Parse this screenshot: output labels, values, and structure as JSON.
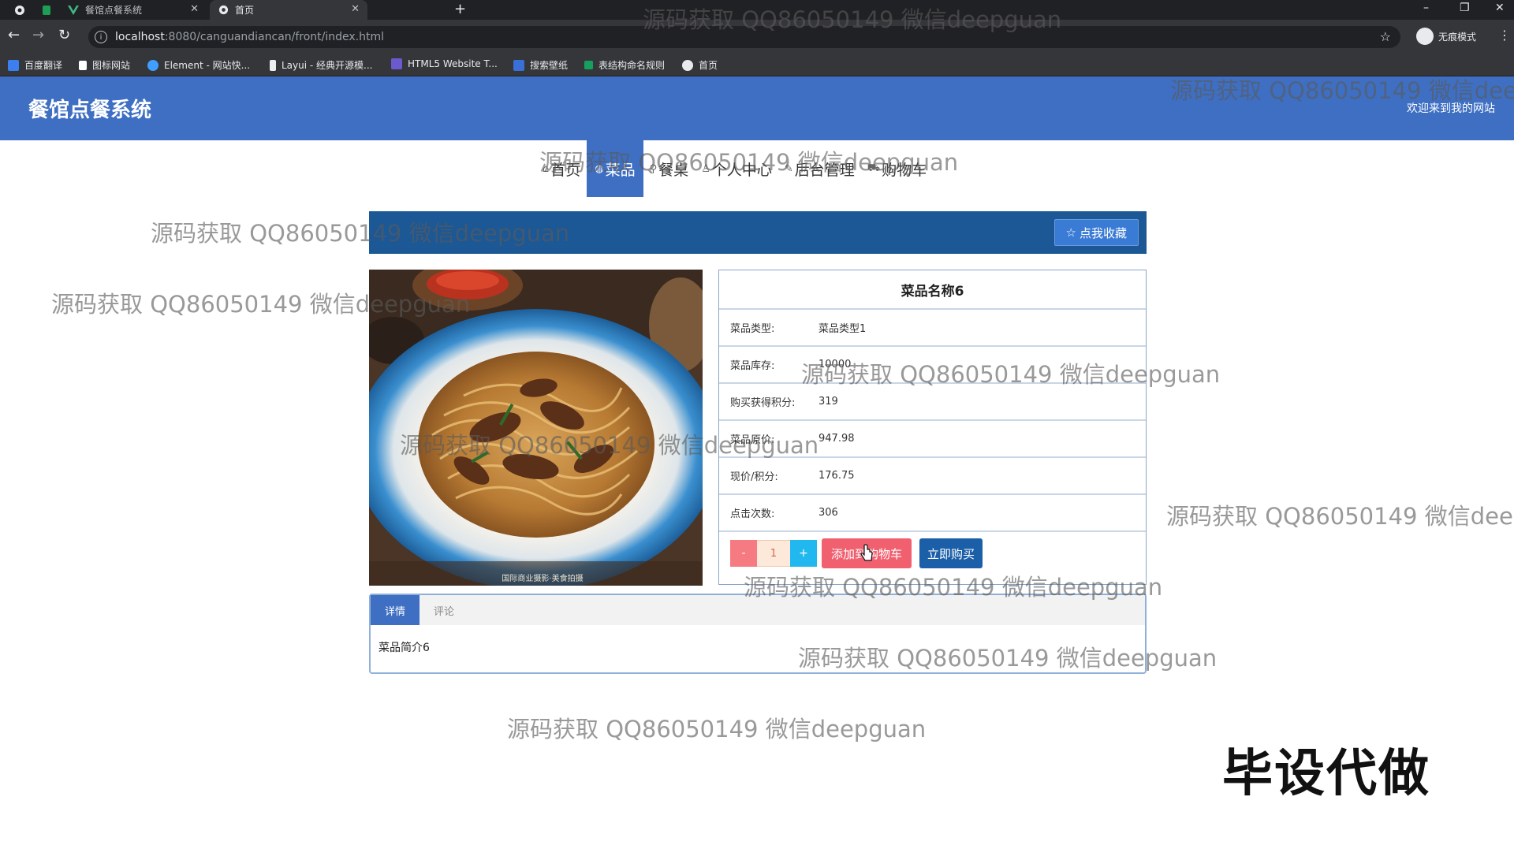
{
  "browser": {
    "tabs": [
      {
        "title": "餐馆点餐系统"
      },
      {
        "title": "首页"
      }
    ],
    "url_host": "localhost",
    "url_rest": ":8080/canguandiancan/front/index.html",
    "incognito_label": "无痕模式",
    "bookmarks": [
      {
        "label": "百度翻译",
        "color": "#3b7ff0"
      },
      {
        "label": "图标网站",
        "color": "#ffffff"
      },
      {
        "label": "Element - 网站快...",
        "color": "#409eff"
      },
      {
        "label": "Layui - 经典开源模...",
        "color": "#eeeeee"
      },
      {
        "label": "HTML5 Website T...",
        "color": "#6a5acd"
      },
      {
        "label": "搜索壁纸",
        "color": "#3b6fd8"
      },
      {
        "label": "表结构命名规则",
        "color": "#16a05d"
      },
      {
        "label": "首页",
        "color": "#e8eaed"
      }
    ]
  },
  "site": {
    "title": "餐馆点餐系统",
    "welcome": "欢迎来到我的网站",
    "nav": [
      {
        "label": "首页",
        "icon": "home-icon",
        "glyph": "⌂"
      },
      {
        "label": "菜品",
        "icon": "globe-icon",
        "glyph": "◍",
        "active": true
      },
      {
        "label": "餐桌",
        "icon": "link-icon",
        "glyph": "⚲"
      },
      {
        "label": "个人中心",
        "icon": "user-icon",
        "glyph": "♙"
      },
      {
        "label": "后台管理",
        "icon": "wrench-icon",
        "glyph": "✎"
      },
      {
        "label": "购物车",
        "icon": "cart-icon",
        "glyph": "⛟"
      }
    ],
    "favorite_button": "点我收藏"
  },
  "product": {
    "name": "菜品名称6",
    "fields": [
      {
        "label": "菜品类型:",
        "value": "菜品类型1"
      },
      {
        "label": "菜品库存:",
        "value": "10000"
      },
      {
        "label": "购买获得积分:",
        "value": "319"
      },
      {
        "label": "菜品原价:",
        "value": "947.98"
      },
      {
        "label": "现价/积分:",
        "value": "176.75"
      },
      {
        "label": "点击次数:",
        "value": "306"
      }
    ],
    "quantity": "1",
    "minus_label": "-",
    "plus_label": "+",
    "add_to_cart": "添加到购物车",
    "buy_now": "立即购买",
    "photo_caption": "国际商业摄影·美食拍摄",
    "tabs": [
      {
        "label": "详情",
        "active": true
      },
      {
        "label": "评论"
      }
    ],
    "description": "菜品简介6"
  },
  "watermark": "源码获取 QQ86050149 微信deepguan",
  "stamp": "毕设代做"
}
